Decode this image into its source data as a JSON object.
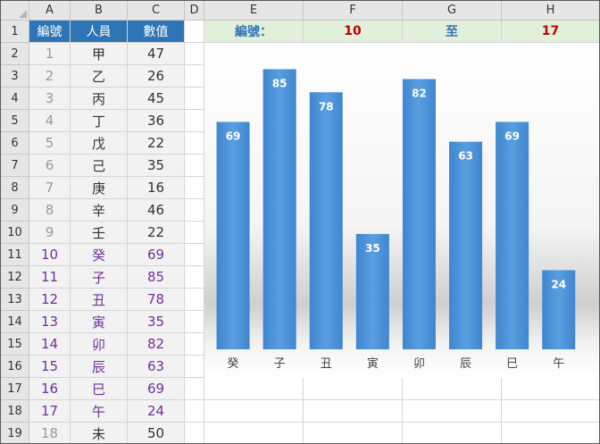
{
  "columns": [
    "A",
    "B",
    "C",
    "D",
    "E",
    "F",
    "G",
    "H"
  ],
  "rows": [
    "1",
    "2",
    "3",
    "4",
    "5",
    "6",
    "7",
    "8",
    "9",
    "10",
    "11",
    "12",
    "13",
    "14",
    "15",
    "16",
    "17",
    "18",
    "19"
  ],
  "table": {
    "headers": [
      "編號",
      "人員",
      "數值"
    ],
    "records": [
      {
        "id": "1",
        "name": "甲",
        "value": "47"
      },
      {
        "id": "2",
        "name": "乙",
        "value": "26"
      },
      {
        "id": "3",
        "name": "丙",
        "value": "45"
      },
      {
        "id": "4",
        "name": "丁",
        "value": "36"
      },
      {
        "id": "5",
        "name": "戊",
        "value": "22"
      },
      {
        "id": "6",
        "name": "己",
        "value": "35"
      },
      {
        "id": "7",
        "name": "庚",
        "value": "16"
      },
      {
        "id": "8",
        "name": "辛",
        "value": "46"
      },
      {
        "id": "9",
        "name": "壬",
        "value": "22"
      },
      {
        "id": "10",
        "name": "癸",
        "value": "69"
      },
      {
        "id": "11",
        "name": "子",
        "value": "85"
      },
      {
        "id": "12",
        "name": "丑",
        "value": "78"
      },
      {
        "id": "13",
        "name": "寅",
        "value": "35"
      },
      {
        "id": "14",
        "name": "卯",
        "value": "82"
      },
      {
        "id": "15",
        "name": "辰",
        "value": "63"
      },
      {
        "id": "16",
        "name": "巳",
        "value": "69"
      },
      {
        "id": "17",
        "name": "午",
        "value": "24"
      },
      {
        "id": "18",
        "name": "未",
        "value": "50"
      }
    ],
    "range_start_id": 10,
    "range_end_id": 17
  },
  "filter": {
    "label": "編號：",
    "from": "10",
    "to_word": "至",
    "to": "17"
  },
  "chart_data": {
    "type": "bar",
    "categories": [
      "癸",
      "子",
      "丑",
      "寅",
      "卯",
      "辰",
      "巳",
      "午"
    ],
    "values": [
      69,
      85,
      78,
      35,
      82,
      63,
      69,
      24
    ],
    "title": "",
    "xlabel": "",
    "ylabel": "",
    "ylim": [
      0,
      90
    ],
    "data_labels": true,
    "grid": false,
    "bar_color": "#4a90d9"
  },
  "colors": {
    "header_fill": "#2e75b6",
    "highlight_text": "#7030a0",
    "filter_row_fill": "#e2efda",
    "number_red": "#c00000"
  }
}
